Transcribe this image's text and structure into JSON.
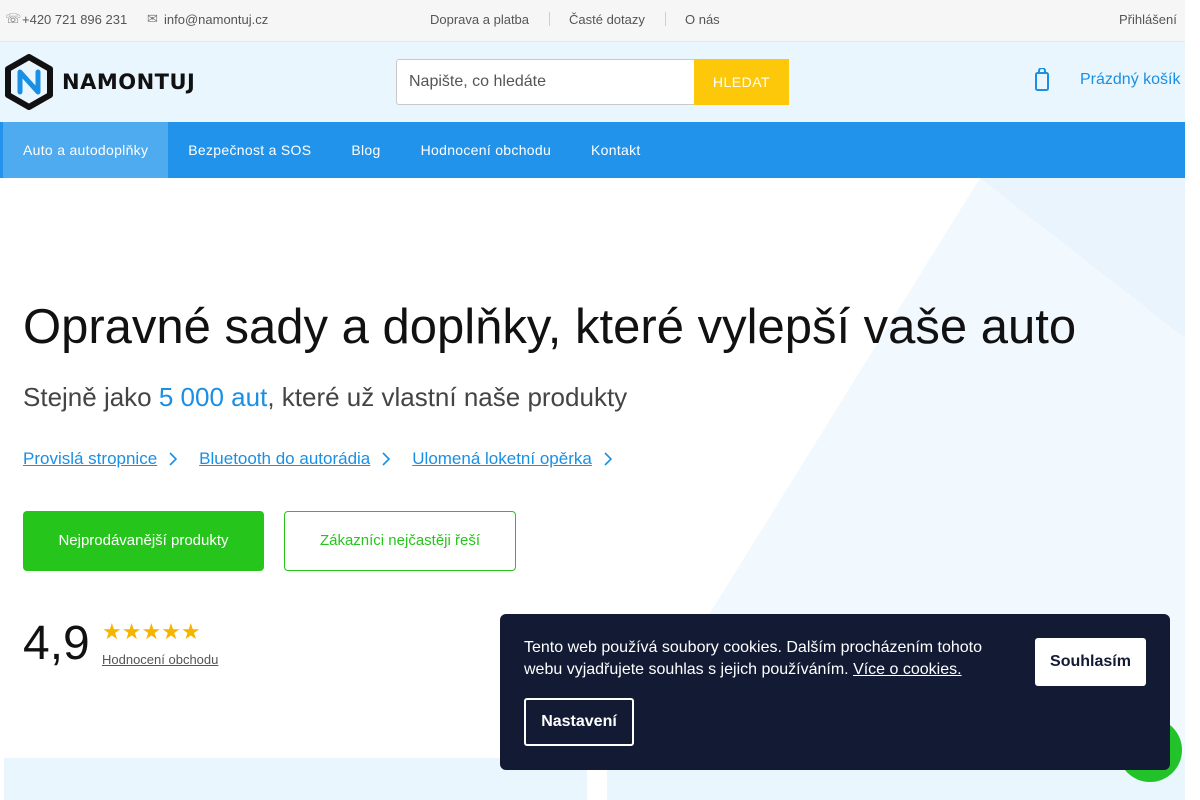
{
  "topbar": {
    "phone": "+420 721 896 231",
    "email": "info@namontuj.cz",
    "links": [
      "Doprava a platba",
      "Časté dotazy",
      "O nás"
    ],
    "login": "Přihlášení",
    "phone_icon": "phone-icon",
    "email_icon": "envelope-icon"
  },
  "header": {
    "logo_text": "NAMONTUJ",
    "search_placeholder": "Napište, co hledáte",
    "search_button": "HLEDAT",
    "cart_label": "Prázdný košík",
    "cart_icon": "cart-icon"
  },
  "nav": {
    "items": [
      "Auto a autodoplňky",
      "Bezpečnost a SOS",
      "Blog",
      "Hodnocení obchodu",
      "Kontakt"
    ],
    "active": "Auto a autodoplňky"
  },
  "hero": {
    "title": "Opravné sady a doplňky, které vylepší vaše auto",
    "subtitle_pre": "Stejně jako ",
    "subtitle_highlight": "5 000 aut",
    "subtitle_post": ", které už vlastní naše produkty",
    "links": [
      "Provislá stropnice",
      "Bluetooth do autorádia",
      "Ulomená loketní opěrka"
    ],
    "primary_button": "Nejprodávanější produkty",
    "secondary_button": "Zákazníci nejčastěji řeší",
    "rating_value": "4,9",
    "rating_stars": "★★★★★",
    "rating_link": "Hodnocení obchodu"
  },
  "cookie": {
    "text": "Tento web používá soubory cookies. Dalším procházením tohoto webu vyjadřujete souhlas s jejich používáním. ",
    "more_link": "Více o cookies.",
    "accept": "Souhlasím",
    "settings": "Nastavení"
  },
  "colors": {
    "brand_blue": "#2293ea",
    "accent_yellow": "#fec80a",
    "cta_green": "#26c51c",
    "cookie_bg": "#131a33"
  }
}
